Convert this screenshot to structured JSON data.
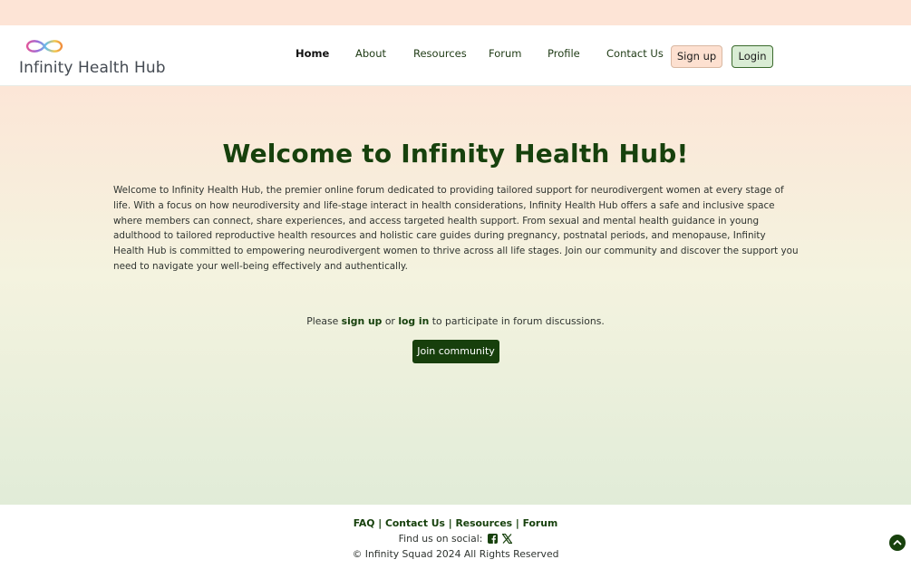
{
  "brand": {
    "name": "Infinity Health Hub",
    "logo_icon": "infinity-rainbow-icon"
  },
  "nav": {
    "items": [
      {
        "label": "Home",
        "active": true
      },
      {
        "label": "About",
        "active": false
      },
      {
        "label": "Resources",
        "active": false
      },
      {
        "label": "Forum",
        "active": false
      },
      {
        "label": "Profile",
        "active": false
      },
      {
        "label": "Contact Us",
        "active": false
      }
    ],
    "signup_label": "Sign up",
    "login_label": "Login"
  },
  "main": {
    "title": "Welcome to Infinity Health Hub!",
    "intro": "Welcome to Infinity Health Hub, the premier online forum dedicated to providing tailored support for neurodivergent women at every stage of life. With a focus on how neurodiversity and life-stage interact in health considerations, Infinity Health Hub offers a safe and inclusive space where members can connect, share experiences, and access targeted health support. From sexual and mental health guidance in young adulthood to tailored reproductive health resources and holistic care guides during pregnancy, postnatal periods, and menopause, Infinity Health Hub is committed to empowering neurodivergent women to thrive across all life stages. Join our community and discover the support you need to navigate your well-being effectively and authentically.",
    "cta": {
      "prefix": "Please ",
      "signup_link": "sign up",
      "middle": " or ",
      "login_link": "log in",
      "suffix": " to participate in forum discussions."
    },
    "join_button": "Join community"
  },
  "footer": {
    "links": [
      "FAQ",
      "Contact Us",
      "Resources",
      "Forum"
    ],
    "separator": "|",
    "social_label": "Find us on social:",
    "social_icons": [
      "facebook-square-icon",
      "x-twitter-icon"
    ],
    "copyright": "© Infinity Squad 2024 All Rights Reserved"
  },
  "colors": {
    "brand_green": "#17410d",
    "peach": "#fde4d6",
    "login_bg": "#d9ecd4"
  }
}
